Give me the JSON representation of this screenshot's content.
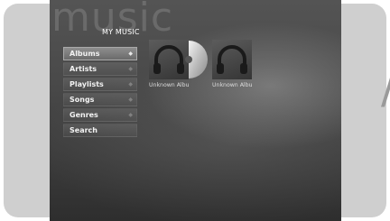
{
  "watermark": "music",
  "page_title": "MY MUSIC",
  "menu": {
    "items": [
      {
        "label": "Albums",
        "selected": true
      },
      {
        "label": "Artists",
        "selected": false
      },
      {
        "label": "Playlists",
        "selected": false
      },
      {
        "label": "Songs",
        "selected": false
      },
      {
        "label": "Genres",
        "selected": false
      },
      {
        "label": "Search",
        "selected": false
      }
    ]
  },
  "albums": [
    {
      "label": "Unknown Albu",
      "icon": "headphones-icon",
      "playing": true
    },
    {
      "label": "Unknown Albu",
      "icon": "headphones-icon",
      "playing": false
    }
  ],
  "colors": {
    "screen_bg": "#454545",
    "bezel": "#cfcfcf",
    "selected_item": "#7c7c7c",
    "text": "#ffffff"
  }
}
